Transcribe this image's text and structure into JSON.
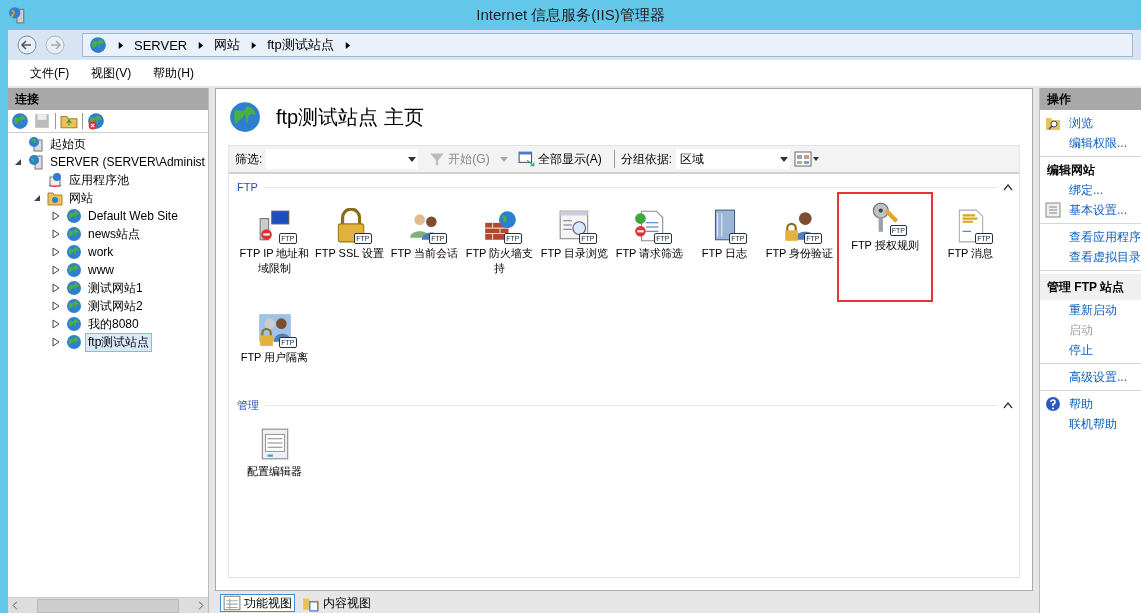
{
  "window": {
    "title": "Internet 信息服务(IIS)管理器"
  },
  "breadcrumb": [
    "SERVER",
    "网站",
    "ftp测试站点"
  ],
  "menu": [
    "文件(F)",
    "视图(V)",
    "帮助(H)"
  ],
  "connections": {
    "title": "连接",
    "tree": [
      {
        "label": "起始页",
        "kind": "start",
        "selected": false
      },
      {
        "label": "SERVER (SERVER\\Administ",
        "kind": "server",
        "expanded": true,
        "selected": false,
        "children": [
          {
            "label": "应用程序池",
            "kind": "pool",
            "selected": false
          },
          {
            "label": "网站",
            "kind": "folder",
            "expanded": true,
            "selected": false,
            "children": [
              {
                "label": "Default Web Site",
                "kind": "site",
                "expanded": false,
                "selected": false
              },
              {
                "label": "news站点",
                "kind": "site",
                "expanded": false,
                "selected": false
              },
              {
                "label": "work",
                "kind": "site",
                "expanded": false,
                "selected": false
              },
              {
                "label": "www",
                "kind": "site",
                "expanded": false,
                "selected": false
              },
              {
                "label": "测试网站1",
                "kind": "site",
                "expanded": false,
                "selected": false
              },
              {
                "label": "测试网站2",
                "kind": "site",
                "expanded": false,
                "selected": false
              },
              {
                "label": "我的8080",
                "kind": "site",
                "expanded": false,
                "selected": false
              },
              {
                "label": "ftp测试站点",
                "kind": "site",
                "expanded": false,
                "selected": true
              }
            ]
          }
        ]
      }
    ]
  },
  "page": {
    "title": "ftp测试站点 主页",
    "filter": {
      "label": "筛选:",
      "go": "开始(G)",
      "go_disabled": true,
      "show_all": "全部显示(A)",
      "group_label": "分组依据:",
      "group_value": "区域"
    },
    "groups": [
      {
        "title": "FTP",
        "items": [
          {
            "label": "FTP IP 地址和域限制",
            "badge": "FTP",
            "highlighted": false
          },
          {
            "label": "FTP SSL 设置",
            "badge": "FTP",
            "highlighted": false
          },
          {
            "label": "FTP 当前会话",
            "badge": "FTP",
            "highlighted": false
          },
          {
            "label": "FTP 防火墙支持",
            "badge": "FTP",
            "highlighted": false
          },
          {
            "label": "FTP 目录浏览",
            "badge": "FTP",
            "highlighted": false
          },
          {
            "label": "FTP 请求筛选",
            "badge": "FTP",
            "highlighted": false
          },
          {
            "label": "FTP 日志",
            "badge": "FTP",
            "highlighted": false
          },
          {
            "label": "FTP 身份验证",
            "badge": "FTP",
            "highlighted": false
          },
          {
            "label": "FTP 授权规则",
            "badge": "FTP",
            "highlighted": true
          },
          {
            "label": "FTP 消息",
            "badge": "FTP",
            "highlighted": false
          },
          {
            "label": "FTP 用户隔离",
            "badge": "FTP",
            "highlighted": false
          }
        ]
      },
      {
        "title": "管理",
        "items": [
          {
            "label": "配置编辑器",
            "highlighted": false
          }
        ]
      }
    ]
  },
  "view_tabs": [
    {
      "label": "功能视图",
      "selected": true
    },
    {
      "label": "内容视图",
      "selected": false
    }
  ],
  "actions": {
    "title": "操作",
    "groups": [
      {
        "items": [
          {
            "label": "浏览",
            "disabled": false
          },
          {
            "label": "编辑权限...",
            "disabled": false
          }
        ]
      },
      {
        "heading": "编辑网站",
        "shaded": false,
        "items": [
          {
            "label": "绑定...",
            "disabled": false
          },
          {
            "label": "基本设置...",
            "disabled": false
          }
        ]
      },
      {
        "items": [
          {
            "label": "查看应用程序",
            "disabled": false
          },
          {
            "label": "查看虚拟目录",
            "disabled": false
          }
        ]
      },
      {
        "heading": "管理 FTP 站点",
        "shaded": true,
        "items": [
          {
            "label": "重新启动",
            "disabled": false
          },
          {
            "label": "启动",
            "disabled": true
          },
          {
            "label": "停止",
            "disabled": false
          }
        ]
      },
      {
        "items": [
          {
            "label": "高级设置...",
            "disabled": false
          }
        ]
      },
      {
        "items": [
          {
            "label": "帮助",
            "disabled": false
          },
          {
            "label": "联机帮助",
            "disabled": false
          }
        ]
      }
    ]
  }
}
